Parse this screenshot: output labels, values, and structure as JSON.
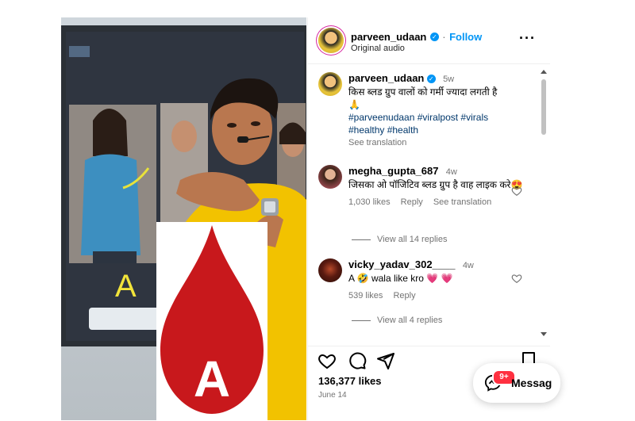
{
  "post": {
    "username": "parveen_udaan",
    "follow_label": "Follow",
    "audio": "Original audio",
    "caption_time": "5w",
    "caption": "किस ब्लड ग्रुप वालों को गर्मी ज्यादा लगती है",
    "caption_emoji": "🙏",
    "hashtags": "#parveenudaan #viralpost #virals",
    "hashtags2": "#healthy #health",
    "see_translation": "See translation",
    "likes": "136,377 likes",
    "date": "June 14"
  },
  "comments": [
    {
      "username": "megha_gupta_687",
      "time": "4w",
      "text": "जिसका ओ पॉजिटिव ब्लड ग्रुप है वाह लाइक करे😍",
      "likes": "1,030 likes",
      "reply": "Reply",
      "see_translation": "See translation",
      "view_replies": "View all 14 replies"
    },
    {
      "username": "vicky_yadav_302____",
      "time": "4w",
      "text": "A 🤣 wala like kro 💗 💗",
      "likes": "539 likes",
      "reply": "Reply",
      "view_replies": "View all 4 replies"
    }
  ],
  "media": {
    "board_label": "A",
    "drop_label": "A"
  },
  "messages": {
    "label": "Messag",
    "badge": "9+"
  },
  "colors": {
    "accent": "#0095f6",
    "drop": "#c8181c",
    "shirt": "#f2c200"
  }
}
